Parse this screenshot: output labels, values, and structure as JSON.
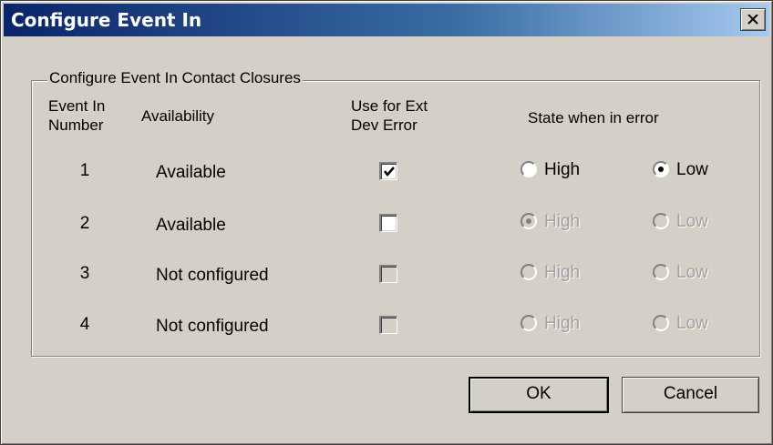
{
  "window": {
    "title": "Configure Event In",
    "close_icon": "close-x-icon"
  },
  "group": {
    "legend": "Configure Event In Contact Closures"
  },
  "headers": {
    "event_in_line1": "Event In",
    "event_in_line2": "Number",
    "availability": "Availability",
    "use_line1": "Use for Ext",
    "use_line2": "Dev Error",
    "state": "State when in error"
  },
  "rows": [
    {
      "number": "1",
      "availability": "Available",
      "use_checked": true,
      "use_enabled": true,
      "high_label": "High",
      "low_label": "Low",
      "selected": "Low",
      "state_enabled": true
    },
    {
      "number": "2",
      "availability": "Available",
      "use_checked": false,
      "use_enabled": true,
      "high_label": "High",
      "low_label": "Low",
      "selected": "High",
      "state_enabled": false
    },
    {
      "number": "3",
      "availability": "Not configured",
      "use_checked": false,
      "use_enabled": false,
      "high_label": "High",
      "low_label": "Low",
      "selected": "",
      "state_enabled": false
    },
    {
      "number": "4",
      "availability": "Not configured",
      "use_checked": false,
      "use_enabled": false,
      "high_label": "High",
      "low_label": "Low",
      "selected": "",
      "state_enabled": false
    }
  ],
  "buttons": {
    "ok": "OK",
    "cancel": "Cancel"
  }
}
